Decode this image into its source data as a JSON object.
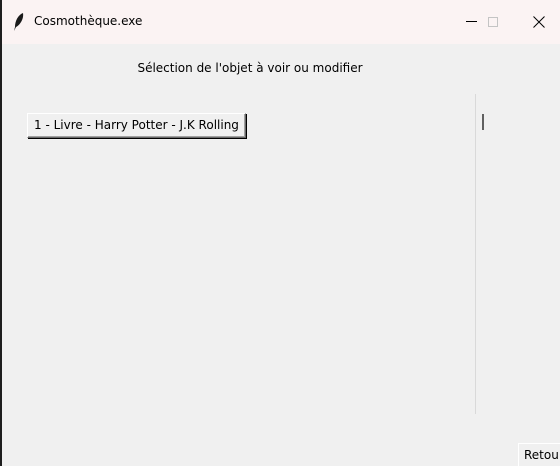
{
  "window": {
    "title": "Cosmothèque.exe",
    "icon": "feather-icon",
    "controls": {
      "minimize": "minimize-icon",
      "maximize": "maximize-icon",
      "close": "close-icon"
    }
  },
  "main": {
    "heading": "Sélection de l'objet à voir ou modifier",
    "items": [
      {
        "label": "1 - Livre - Harry Potter - J.K Rolling"
      }
    ]
  },
  "footer": {
    "back_label": "Retou"
  },
  "colors": {
    "background": "#f0f0f0",
    "titlebar": "#fbf3f3"
  }
}
